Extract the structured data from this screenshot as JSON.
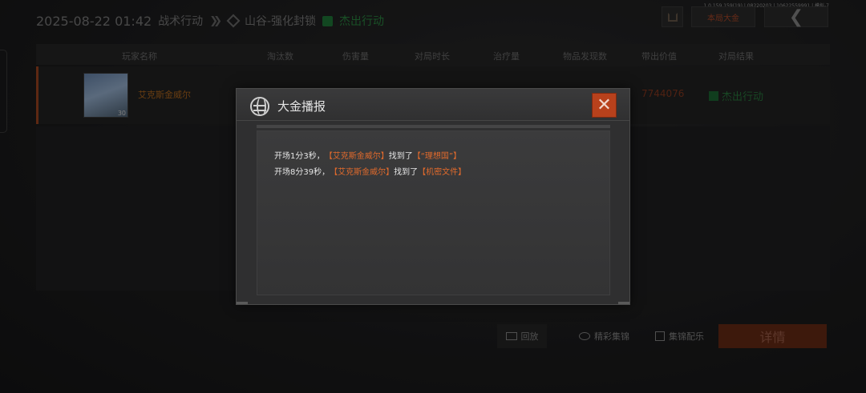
{
  "version_text": "1.0.159.159(19) | 08220203 | 10622559991 | 模拟-7",
  "header": {
    "datetime": "2025-08-22 01:42",
    "mode": "战术行动",
    "map": "山谷-强化封锁",
    "result": "杰出行动"
  },
  "toolbar": {
    "gold_label": "本局大金",
    "back_glyph": "❮"
  },
  "table": {
    "columns": [
      "玩家名称",
      "淘汰数",
      "伤害量",
      "对局时长",
      "治疗量",
      "物品发现数",
      "带出价值",
      "对局结果"
    ],
    "row": {
      "avatar_level": "30",
      "player_name": "艾克斯金威尔",
      "value": "7744076",
      "result": "杰出行动"
    }
  },
  "bottom": {
    "replay": "回放",
    "highlights": "精彩集锦",
    "pick": "集锦配乐",
    "detail": "详情"
  },
  "modal": {
    "title": "大金播报",
    "close_glyph": "✕",
    "messages": [
      {
        "prefix": "开场1分3秒，",
        "player": "【艾克斯金威尔】",
        "verb": "找到了",
        "item": "【“理想国”】"
      },
      {
        "prefix": "开场8分39秒，",
        "player": "【艾克斯金威尔】",
        "verb": "找到了",
        "item": "【机密文件】"
      }
    ]
  },
  "colors": {
    "accent_orange": "#e06a2c",
    "close_red": "#b8411c",
    "success_green": "#2c8a43"
  }
}
